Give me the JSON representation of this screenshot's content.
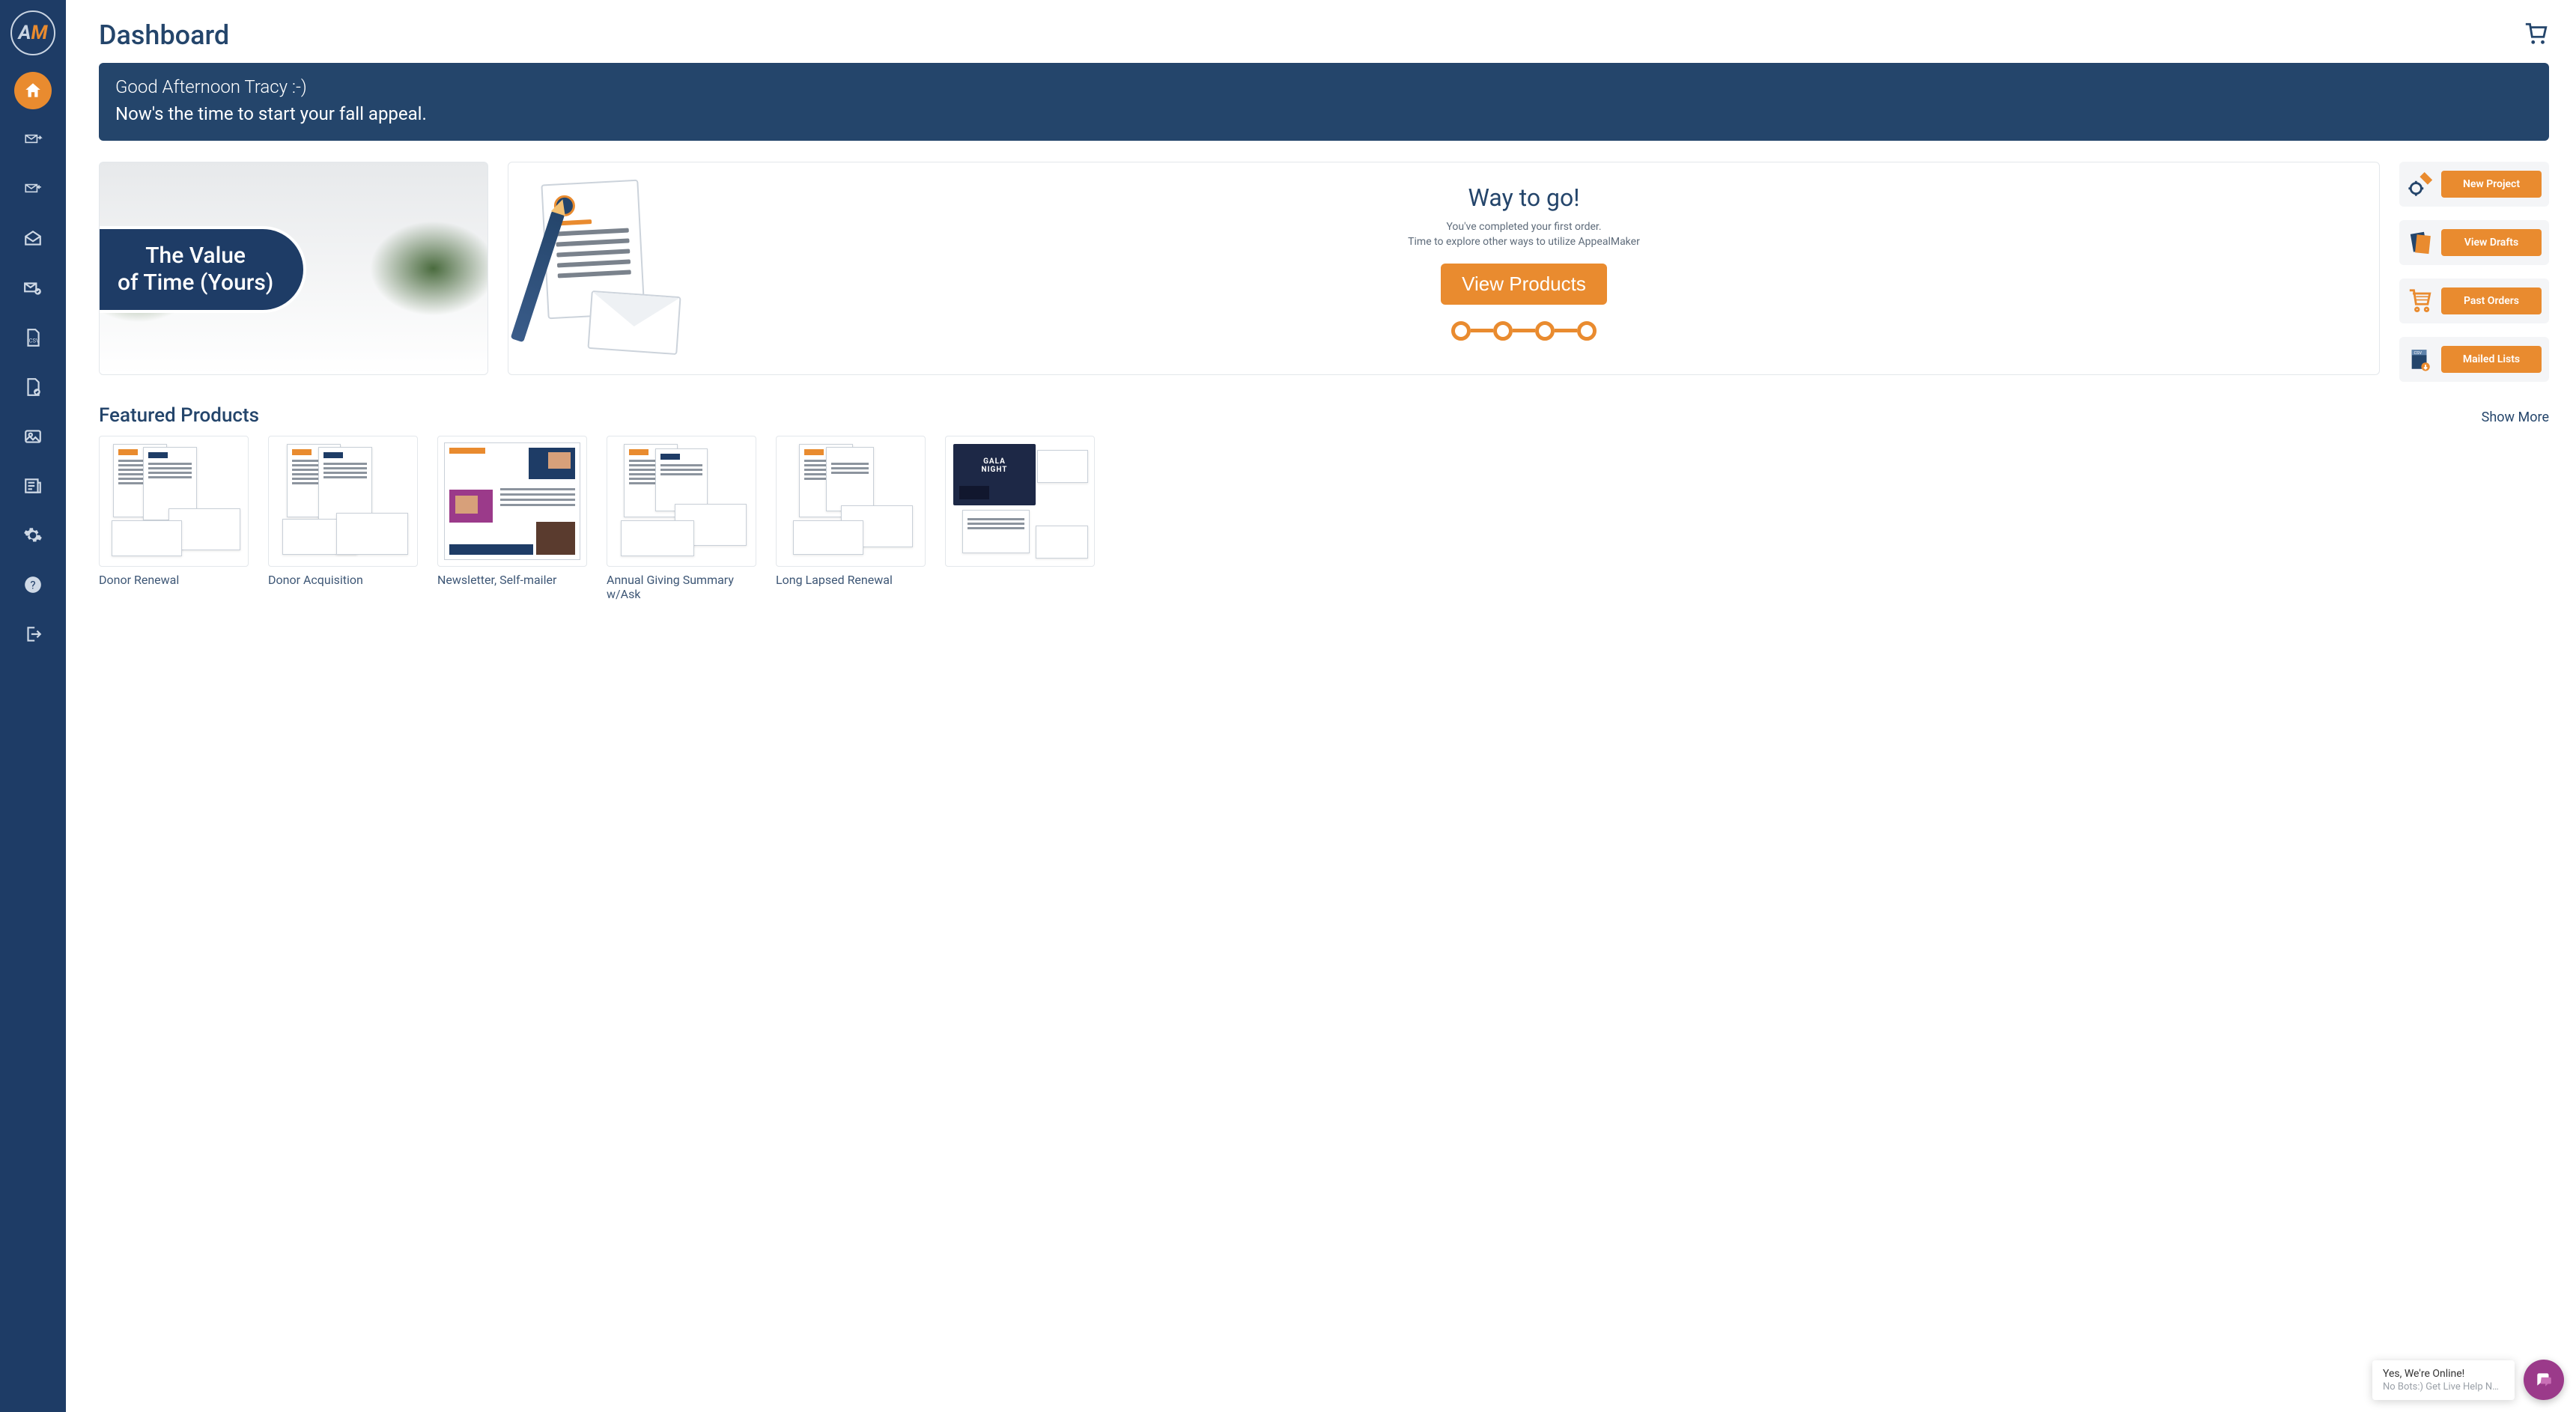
{
  "logo": {
    "a": "A",
    "m": "M"
  },
  "page_title": "Dashboard",
  "banner": {
    "greeting": "Good Afternoon Tracy :-)",
    "tagline": "Now's the time to start your fall appeal."
  },
  "value_time": {
    "line1": "The Value",
    "line2": "of Time (Yours)"
  },
  "waytogo": {
    "heading": "Way to go!",
    "line1": "You've completed your first order.",
    "line2": "Time to explore other ways to utilize AppealMaker",
    "button": "View Products"
  },
  "quick_actions": [
    {
      "label": "New Project"
    },
    {
      "label": "View Drafts"
    },
    {
      "label": "Past Orders"
    },
    {
      "label": "Mailed Lists"
    }
  ],
  "featured": {
    "heading": "Featured Products",
    "show_more": "Show More",
    "products": [
      {
        "title": "Donor Renewal"
      },
      {
        "title": "Donor Acquisition"
      },
      {
        "title": "Newsletter, Self-mailer"
      },
      {
        "title": "Annual Giving Summary w/Ask"
      },
      {
        "title": "Long Lapsed Renewal"
      },
      {
        "title": ""
      }
    ]
  },
  "chat": {
    "line1": "Yes, We're Online!",
    "line2": "No Bots:) Get Live Help No…"
  }
}
